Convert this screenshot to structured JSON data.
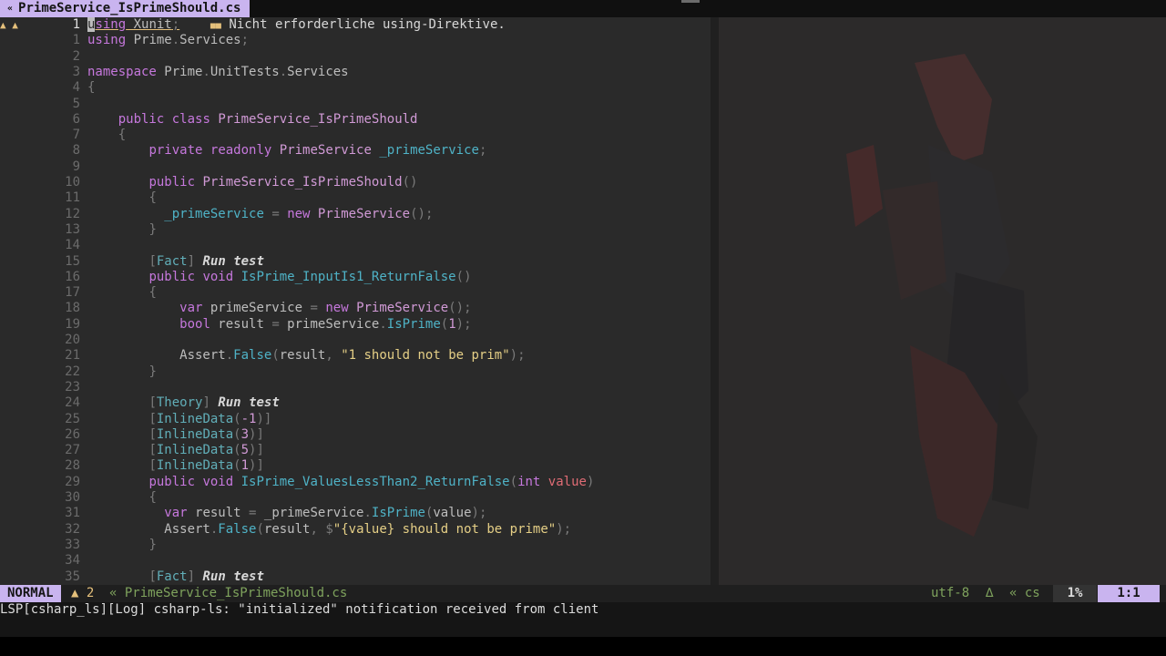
{
  "tab": {
    "icon": "csharp-icon",
    "title": "PrimeService_IsPrimeShould.cs"
  },
  "diagnostic": {
    "signs": "▲ ▲",
    "message": "Nicht erforderliche using-Direktive."
  },
  "lens_label": "Run test",
  "lines": [
    {
      "n": "1",
      "text": "using Xunit;"
    },
    {
      "n": "1",
      "text": "using Prime.Services;"
    },
    {
      "n": "2",
      "text": ""
    },
    {
      "n": "3",
      "text": "namespace Prime.UnitTests.Services"
    },
    {
      "n": "4",
      "text": "{"
    },
    {
      "n": "5",
      "text": ""
    },
    {
      "n": "6",
      "text": "    public class PrimeService_IsPrimeShould"
    },
    {
      "n": "7",
      "text": "    {"
    },
    {
      "n": "8",
      "text": "        private readonly PrimeService _primeService;"
    },
    {
      "n": "9",
      "text": ""
    },
    {
      "n": "10",
      "text": "        public PrimeService_IsPrimeShould()"
    },
    {
      "n": "11",
      "text": "        {"
    },
    {
      "n": "12",
      "text": "          _primeService = new PrimeService();"
    },
    {
      "n": "13",
      "text": "        }"
    },
    {
      "n": "14",
      "text": ""
    },
    {
      "n": "15",
      "text": "        [Fact] Run test"
    },
    {
      "n": "16",
      "text": "        public void IsPrime_InputIs1_ReturnFalse()"
    },
    {
      "n": "17",
      "text": "        {"
    },
    {
      "n": "18",
      "text": "            var primeService = new PrimeService();"
    },
    {
      "n": "19",
      "text": "            bool result = primeService.IsPrime(1);"
    },
    {
      "n": "20",
      "text": ""
    },
    {
      "n": "21",
      "text": "            Assert.False(result, \"1 should not be prim\");"
    },
    {
      "n": "22",
      "text": "        }"
    },
    {
      "n": "23",
      "text": ""
    },
    {
      "n": "24",
      "text": "        [Theory] Run test"
    },
    {
      "n": "25",
      "text": "        [InlineData(-1)]"
    },
    {
      "n": "26",
      "text": "        [InlineData(3)]"
    },
    {
      "n": "27",
      "text": "        [InlineData(5)]"
    },
    {
      "n": "28",
      "text": "        [InlineData(1)]"
    },
    {
      "n": "29",
      "text": "        public void IsPrime_ValuesLessThan2_ReturnFalse(int value)"
    },
    {
      "n": "30",
      "text": "        {"
    },
    {
      "n": "31",
      "text": "          var result = _primeService.IsPrime(value);"
    },
    {
      "n": "32",
      "text": "          Assert.False(result, $\"{value} should not be prime\");"
    },
    {
      "n": "33",
      "text": "        }"
    },
    {
      "n": "34",
      "text": ""
    },
    {
      "n": "35",
      "text": "        [Fact] Run test"
    }
  ],
  "status": {
    "mode": "NORMAL",
    "warnings": "▲ 2",
    "file": "« PrimeService_IsPrimeShould.cs",
    "encoding": "utf-8",
    "fileformat": "∆",
    "filetype": "« cs",
    "percent": "1%",
    "position": "1:1"
  },
  "message": "LSP[csharp_ls][Log] csharp-ls: \"initialized\" notification received from client"
}
